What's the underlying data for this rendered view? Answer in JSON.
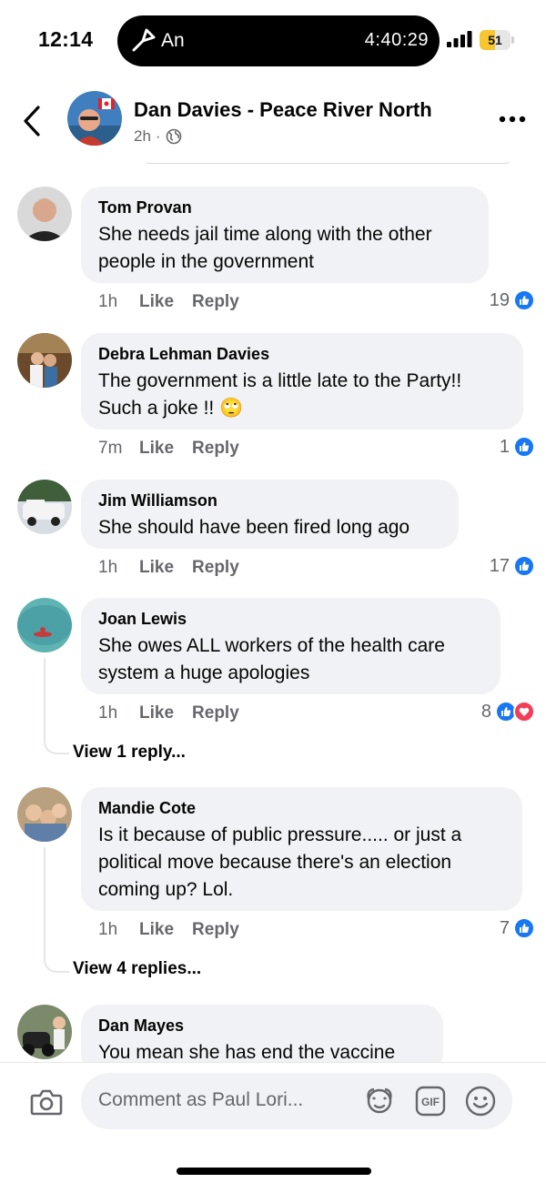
{
  "status_bar": {
    "time": "12:14",
    "island_app": "An",
    "island_timer": "4:40:29",
    "battery_level": "51",
    "battery_fraction": 0.51,
    "battery_color": "#f6c52f"
  },
  "header": {
    "title": "Dan Davies - Peace River North",
    "age": "2h",
    "separator": "·",
    "privacy_icon": "globe-icon"
  },
  "comments": [
    {
      "author": "Tom Provan",
      "text_lines": [
        "She needs jail time along with the other",
        "people in the government"
      ],
      "age": "1h",
      "like_label": "Like",
      "reply_label": "Reply",
      "reactions": "19"
    },
    {
      "author": "Debra Lehman Davies",
      "text_lines": [
        "The government is a little late to the Party!!",
        "Such a joke !! 🙄"
      ],
      "age": "7m",
      "like_label": "Like",
      "reply_label": "Reply",
      "reactions": "1"
    },
    {
      "author": "Jim Williamson",
      "text_lines": [
        "She should have been fired long ago"
      ],
      "age": "1h",
      "like_label": "Like",
      "reply_label": "Reply",
      "reactions": "17"
    },
    {
      "author": "Joan Lewis",
      "text_lines": [
        "She owes ALL workers of the health care",
        "system a huge apologies"
      ],
      "age": "1h",
      "like_label": "Like",
      "reply_label": "Reply",
      "reactions": "8",
      "view_replies": "View 1 reply..."
    },
    {
      "author": "Mandie Cote",
      "text_lines": [
        "Is it because of public pressure..... or just a",
        "political move because there's an election",
        "coming up? Lol."
      ],
      "age": "1h",
      "like_label": "Like",
      "reply_label": "Reply",
      "reactions": "7",
      "view_replies": "View 4 replies..."
    },
    {
      "author": "Dan Mayes",
      "text_lines": [
        "You mean she has end the vaccine"
      ]
    }
  ],
  "composer": {
    "placeholder": "Comment as Paul Lori...",
    "gif_label": "GIF"
  },
  "colors": {
    "like_blue": "#1877f2",
    "love_red": "#f33e58",
    "bubble_bg": "#f0f2f5",
    "meta_gray": "#65676b"
  }
}
